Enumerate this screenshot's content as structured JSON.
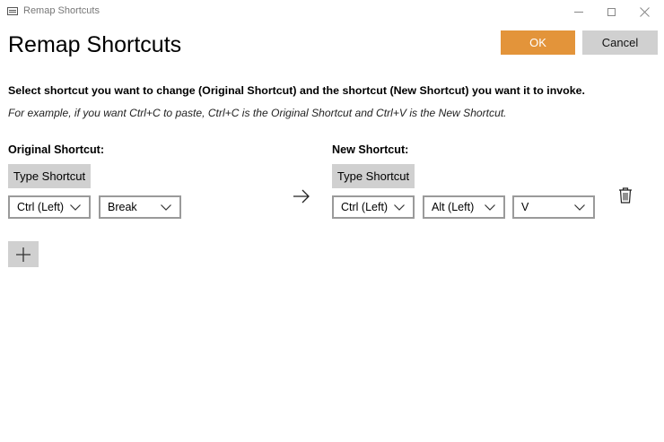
{
  "window": {
    "title": "Remap Shortcuts"
  },
  "heading": "Remap Shortcuts",
  "buttons": {
    "ok": "OK",
    "cancel": "Cancel"
  },
  "instruction": "Select shortcut you want to change (Original Shortcut) and the shortcut (New Shortcut) you want it to invoke.",
  "example": "For example, if you want Ctrl+C to paste, Ctrl+C is the Original Shortcut and Ctrl+V is the New Shortcut.",
  "original": {
    "label": "Original Shortcut:",
    "type_button": "Type Shortcut",
    "keys": [
      "Ctrl (Left)",
      "Break"
    ]
  },
  "new": {
    "label": "New Shortcut:",
    "type_button": "Type Shortcut",
    "keys": [
      "Ctrl (Left)",
      "Alt (Left)",
      "V"
    ]
  },
  "icons": {
    "arrow": "arrow-right-icon",
    "trash": "trash-icon",
    "add": "plus-icon"
  },
  "colors": {
    "accent": "#e3943a",
    "button_gray": "#d0d0d0"
  }
}
